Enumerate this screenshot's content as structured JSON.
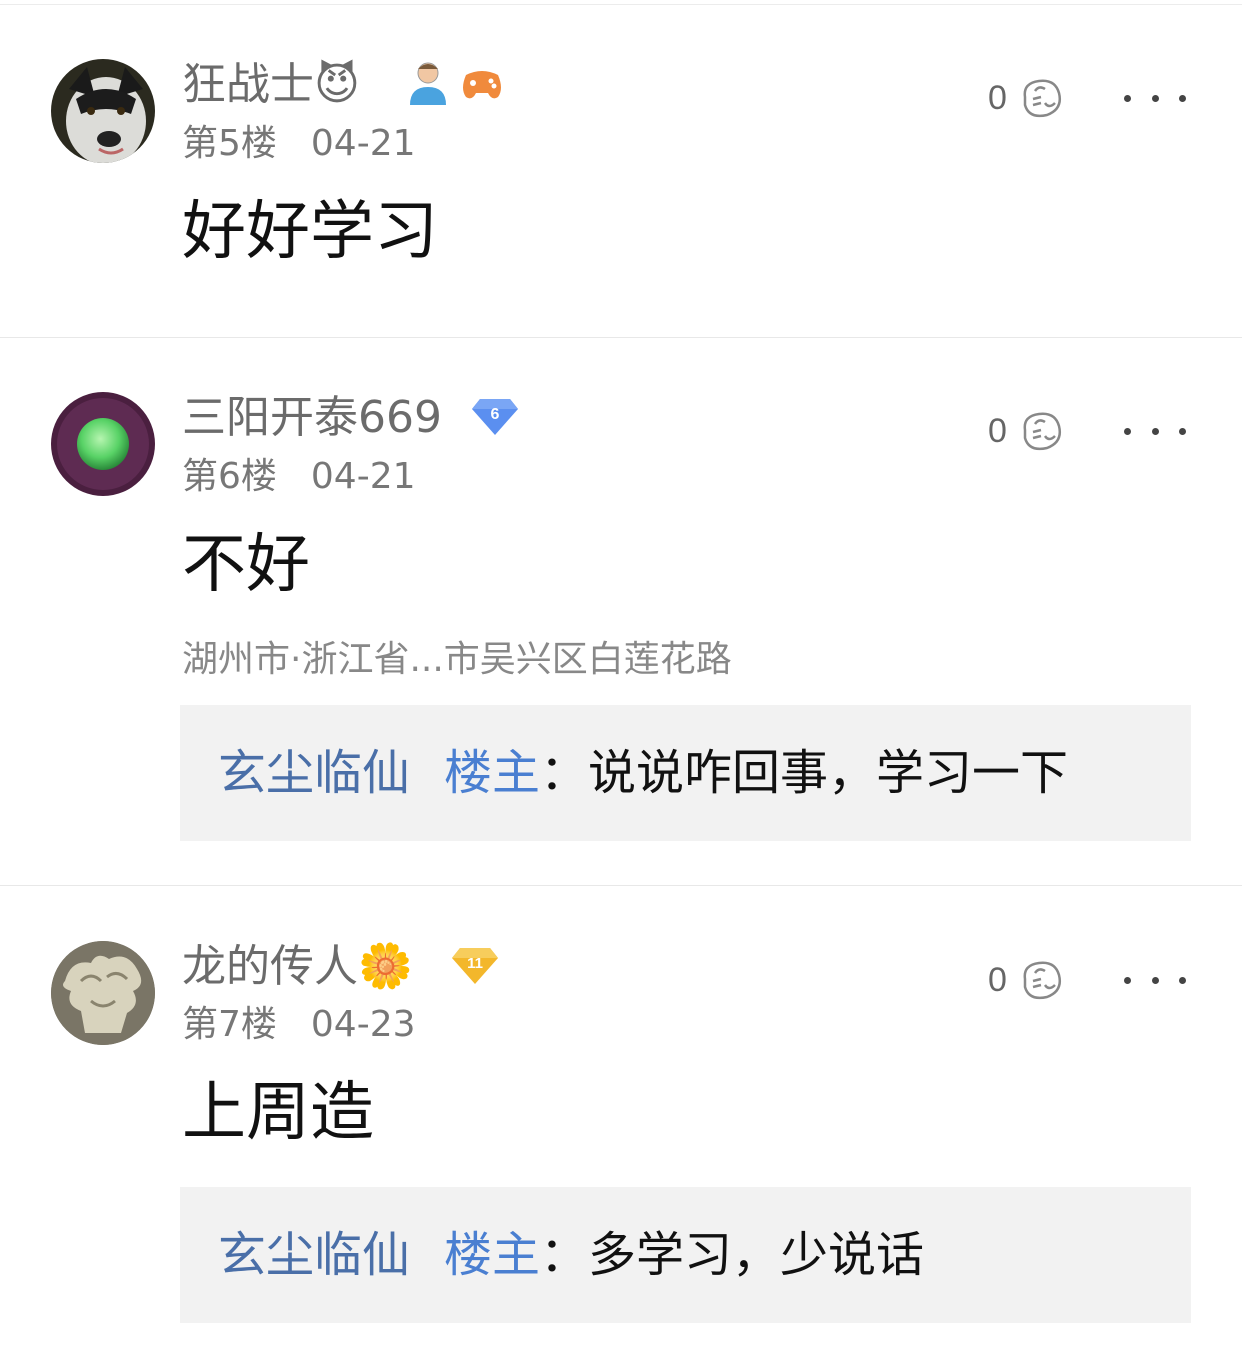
{
  "posts": [
    {
      "username": "狂战士😈",
      "floor": "第5楼",
      "date": "04-21",
      "likes": "0",
      "content": "好好学习",
      "badges": [
        "user-avatar-icon",
        "gamepad-icon"
      ]
    },
    {
      "username": "三阳开泰669",
      "floor": "第6楼",
      "date": "04-21",
      "likes": "0",
      "content": "不好",
      "location": "湖州市·浙江省...市吴兴区白莲花路",
      "level_badge": "6",
      "reply": {
        "author": "玄尘临仙",
        "tag": "楼主",
        "separator": "：",
        "text": "说说咋回事，学习一下"
      }
    },
    {
      "username": "龙的传人🌼",
      "floor": "第7楼",
      "date": "04-23",
      "likes": "0",
      "content": "上周造",
      "level_badge": "11",
      "reply": {
        "author": "玄尘临仙",
        "tag": "楼主",
        "separator": "：",
        "text": "多学习，少说话"
      }
    }
  ],
  "colors": {
    "reply_author": "#4a6fa8",
    "reply_tag": "#4a7fd1",
    "reply_bg": "#f2f2f2",
    "badge_blue": "#5b8ff0",
    "badge_gold": "#f3b72b"
  }
}
